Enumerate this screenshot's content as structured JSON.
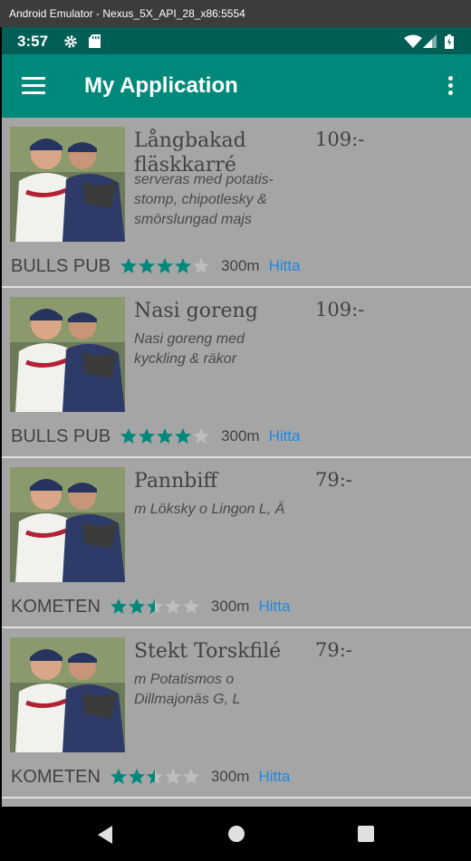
{
  "window": {
    "title": "Android Emulator - Nexus_5X_API_28_x86:5554"
  },
  "status_bar": {
    "time": "3:57",
    "icons": [
      "settings-icon",
      "sd-card-icon",
      "wifi-icon",
      "signal-icon",
      "battery-icon"
    ]
  },
  "app_bar": {
    "title": "My Application"
  },
  "colors": {
    "app_bar": "#00897b",
    "status_bar": "#005e55",
    "star_filled": "#00897b",
    "star_empty": "#bdbdbd",
    "link": "#1e88e5",
    "list_bg": "#a5a5a5"
  },
  "items": [
    {
      "name": "Långbakad fläskkarré",
      "price": "109:-",
      "description": "serveras med potatis-stomp, chipotlesky & smörslungad majs",
      "restaurant": "BULLS PUB",
      "rating": 4,
      "distance": "300m",
      "link": "Hitta"
    },
    {
      "name": "Nasi goreng",
      "price": "109:-",
      "description": "Nasi goreng med kyckling & räkor",
      "restaurant": "BULLS PUB",
      "rating": 4,
      "distance": "300m",
      "link": "Hitta"
    },
    {
      "name": "Pannbiff",
      "price": "79:-",
      "description": "m Löksky o Lingon L, Ä",
      "restaurant": "KOMETEN",
      "rating": 2.5,
      "distance": "300m",
      "link": "Hitta"
    },
    {
      "name": "Stekt Torskfilé",
      "price": "79:-",
      "description": "m Potatismos o Dillmajonäs G, L",
      "restaurant": "KOMETEN",
      "rating": 2.5,
      "distance": "300m",
      "link": "Hitta"
    }
  ],
  "nav_bar": {
    "buttons": [
      "back-icon",
      "home-icon",
      "recents-icon"
    ]
  }
}
